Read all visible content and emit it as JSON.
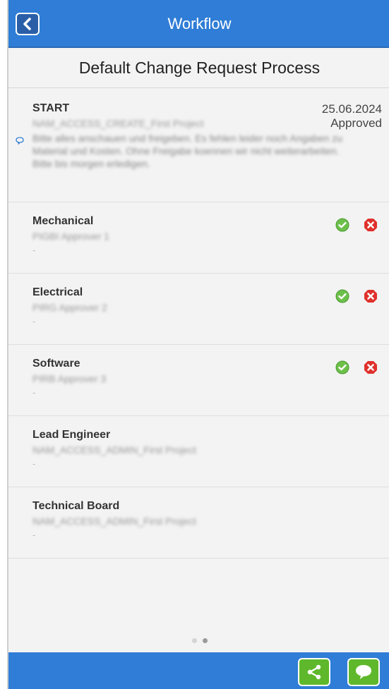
{
  "header": {
    "title": "Workflow",
    "back_icon": "chevron-left-icon"
  },
  "process": {
    "title": "Default Change Request Process"
  },
  "start": {
    "title": "START",
    "date": "25.06.2024",
    "status": "Approved",
    "author": "NAM_ACCESS_CREATE_First Project",
    "comment": "Bitte alles anschauen und freigeben. Es fehlen leider noch Angaben zu Material und Kosten. Ohne Freigabe koennen wir nicht weiterarbeiten. Bitte bis morgen erledigen.",
    "comment_icon": "speech-bubble-icon"
  },
  "steps": [
    {
      "title": "Mechanical",
      "assignee": "PIGBI Approver 1",
      "dash": "-"
    },
    {
      "title": "Electrical",
      "assignee": "PIRG Approver 2",
      "dash": "-"
    },
    {
      "title": "Software",
      "assignee": "PIRB Approver 3",
      "dash": "-"
    },
    {
      "title": "Lead Engineer",
      "assignee": "NAM_ACCESS_ADMIN_First Project",
      "dash": "-"
    },
    {
      "title": "Technical Board",
      "assignee": "NAM_ACCESS_ADMIN_First Project",
      "dash": "-"
    }
  ],
  "icons": {
    "approve": "check-circle-icon",
    "reject": "x-circle-icon",
    "share": "share-icon",
    "chat": "chat-bubble-icon"
  },
  "pager": {
    "pages": 2,
    "active": 2
  },
  "colors": {
    "primary": "#2f7dd6",
    "action_green": "#5fb82b",
    "approve_green": "#6cc04a",
    "reject_red": "#e0312c"
  }
}
